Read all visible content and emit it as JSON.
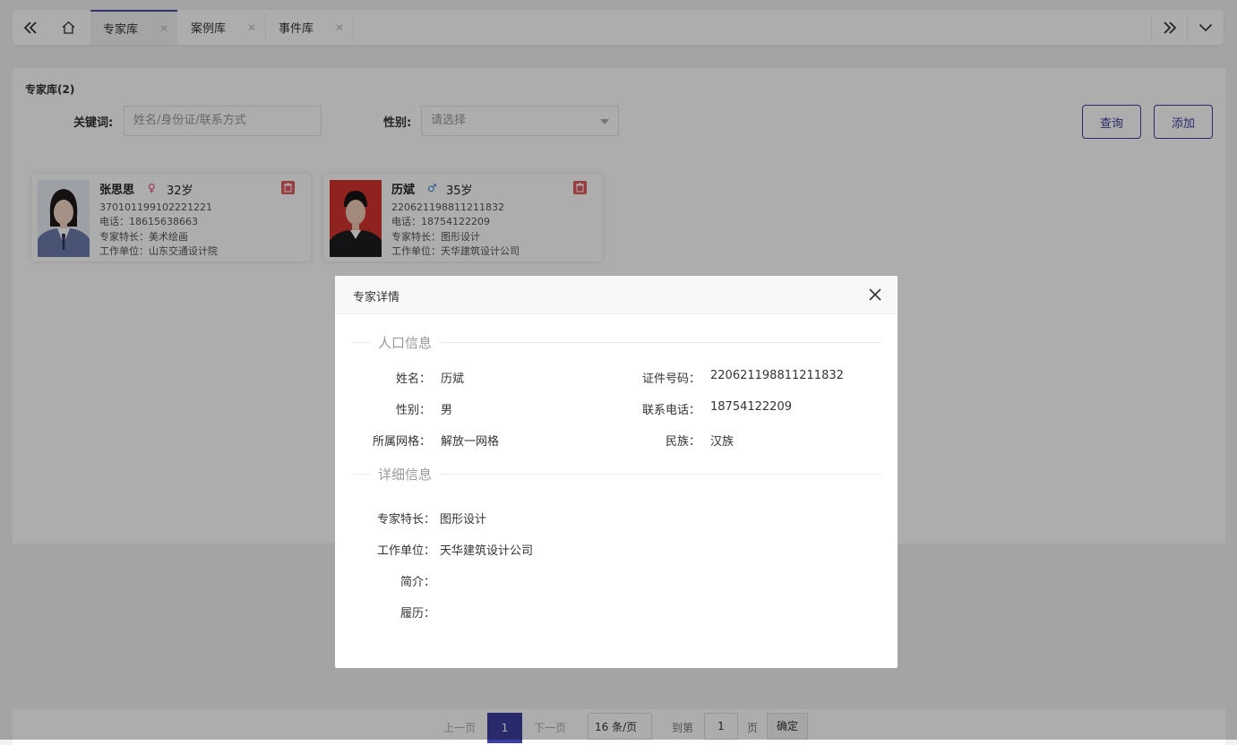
{
  "tabs": [
    {
      "label": "专家库",
      "active": true
    },
    {
      "label": "案例库",
      "active": false
    },
    {
      "label": "事件库",
      "active": false
    }
  ],
  "panel": {
    "title": "专家库(2)",
    "keyword_label": "关键词:",
    "keyword_placeholder": "姓名/身份证/联系方式",
    "gender_label": "性别:",
    "gender_placeholder": "请选择",
    "query_button": "查询",
    "add_button": "添加"
  },
  "experts": [
    {
      "name": "张思思",
      "gender_icon": "female-icon",
      "age": "32岁",
      "id_number": "370101199102221221",
      "phone": "电话：18615638663",
      "specialty": "专家特长：美术绘画",
      "workplace": "工作单位：山东交通设计院"
    },
    {
      "name": "历斌",
      "gender_icon": "male-icon",
      "age": "35岁",
      "id_number": "220621198811211832",
      "phone": "电话：18754122209",
      "specialty": "专家特长：图形设计",
      "workplace": "工作单位：天华建筑设计公司"
    }
  ],
  "pager": {
    "prev": "上一页",
    "current": "1",
    "next": "下一页",
    "page_size": "16 条/页",
    "goto_label": "到第",
    "goto_value": "1",
    "page_unit": "页",
    "confirm": "确定"
  },
  "modal": {
    "title": "专家详情",
    "section1": "人口信息",
    "section2": "详细信息",
    "fields": {
      "name_k": "姓名：",
      "name_v": "历斌",
      "id_k": "证件号码：",
      "id_v": "220621198811211832",
      "gender_k": "性别：",
      "gender_v": "男",
      "phone_k": "联系电话：",
      "phone_v": "18754122209",
      "grid_k": "所属网格：",
      "grid_v": "解放一网格",
      "ethnic_k": "民族：",
      "ethnic_v": "汉族",
      "specialty_k": "专家特长：",
      "specialty_v": "图形设计",
      "workplace_k": "工作单位：",
      "workplace_v": "天华建筑设计公司",
      "intro_k": "简介：",
      "intro_v": "",
      "resume_k": "履历：",
      "resume_v": ""
    }
  },
  "colors": {
    "accent": "#3c3f9e",
    "pager_active": "#3c3fa0",
    "delete": "#e05a5a",
    "female": "#e0456a",
    "male": "#3b7dd8"
  }
}
